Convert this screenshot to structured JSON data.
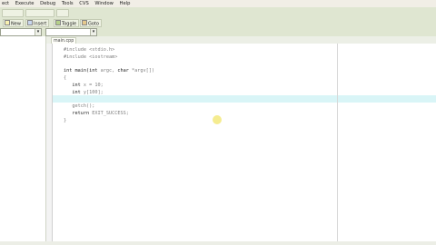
{
  "menubar": {
    "items": [
      "ect",
      "Execute",
      "Debug",
      "Tools",
      "CVS",
      "Window",
      "Help"
    ]
  },
  "toolbar": {
    "buttons": [
      {
        "label": "New"
      },
      {
        "label": "Insert"
      },
      {
        "label": "Toggle"
      },
      {
        "label": "Goto"
      }
    ]
  },
  "editor": {
    "tab_label": "main.cpp",
    "highlighted_line_index": 7,
    "lines": [
      {
        "plain": "#include <stdio.h>"
      },
      {
        "plain": "#include <iostream>"
      },
      {
        "plain": ""
      },
      {
        "kw": "int main(int",
        "plain": " argc, ",
        "kw2": "char",
        "plain2": " *argv[])"
      },
      {
        "plain": "{"
      },
      {
        "plain": "   ",
        "kw": "int",
        "plain2": " x = 10;"
      },
      {
        "plain": "   ",
        "kw": "int",
        "plain2": " y[100];"
      },
      {
        "plain": ""
      },
      {
        "plain": "   getch();"
      },
      {
        "plain": "   ",
        "kw": "return",
        "plain2": " EXIT_SUCCESS;"
      },
      {
        "plain": "}"
      }
    ]
  },
  "colors": {
    "accent": "#dfe6d1",
    "line_highlight": "#d9f5f7",
    "cursor_marker": "#f3e97c"
  }
}
